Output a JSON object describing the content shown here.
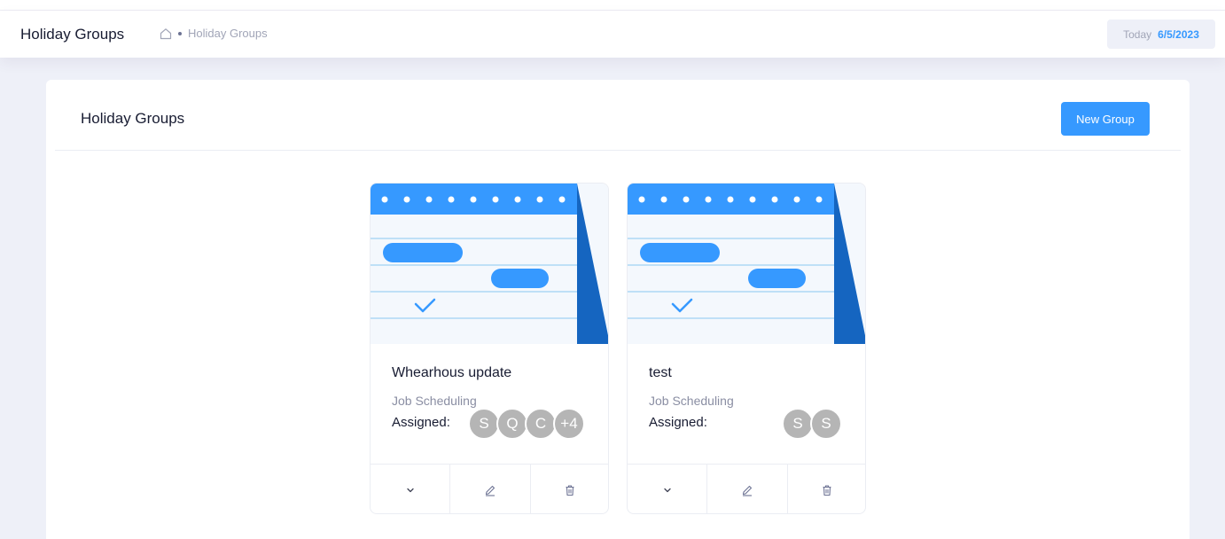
{
  "header": {
    "title": "Holiday Groups",
    "breadcrumb": {
      "home_icon": "home-icon",
      "current": "Holiday Groups"
    },
    "today_label": "Today",
    "today_date": "6/5/2023"
  },
  "main": {
    "title": "Holiday Groups",
    "new_group_label": "New Group"
  },
  "groups": [
    {
      "name": "Whearhous update",
      "type": "Job Scheduling",
      "assigned_label": "Assigned:",
      "avatars": [
        "S",
        "Q",
        "C",
        "+4"
      ],
      "actions": [
        "chevron-down-icon",
        "edit-icon",
        "trash-icon"
      ]
    },
    {
      "name": "test",
      "type": "Job Scheduling",
      "assigned_label": "Assigned:",
      "avatars": [
        "S",
        "S"
      ],
      "actions": [
        "chevron-down-icon",
        "edit-icon",
        "trash-icon"
      ]
    }
  ],
  "colors": {
    "accent": "#3699ff",
    "dark_accent": "#1565c0",
    "avatar": "#b5b5b5",
    "page_bg": "#eef0f8"
  }
}
